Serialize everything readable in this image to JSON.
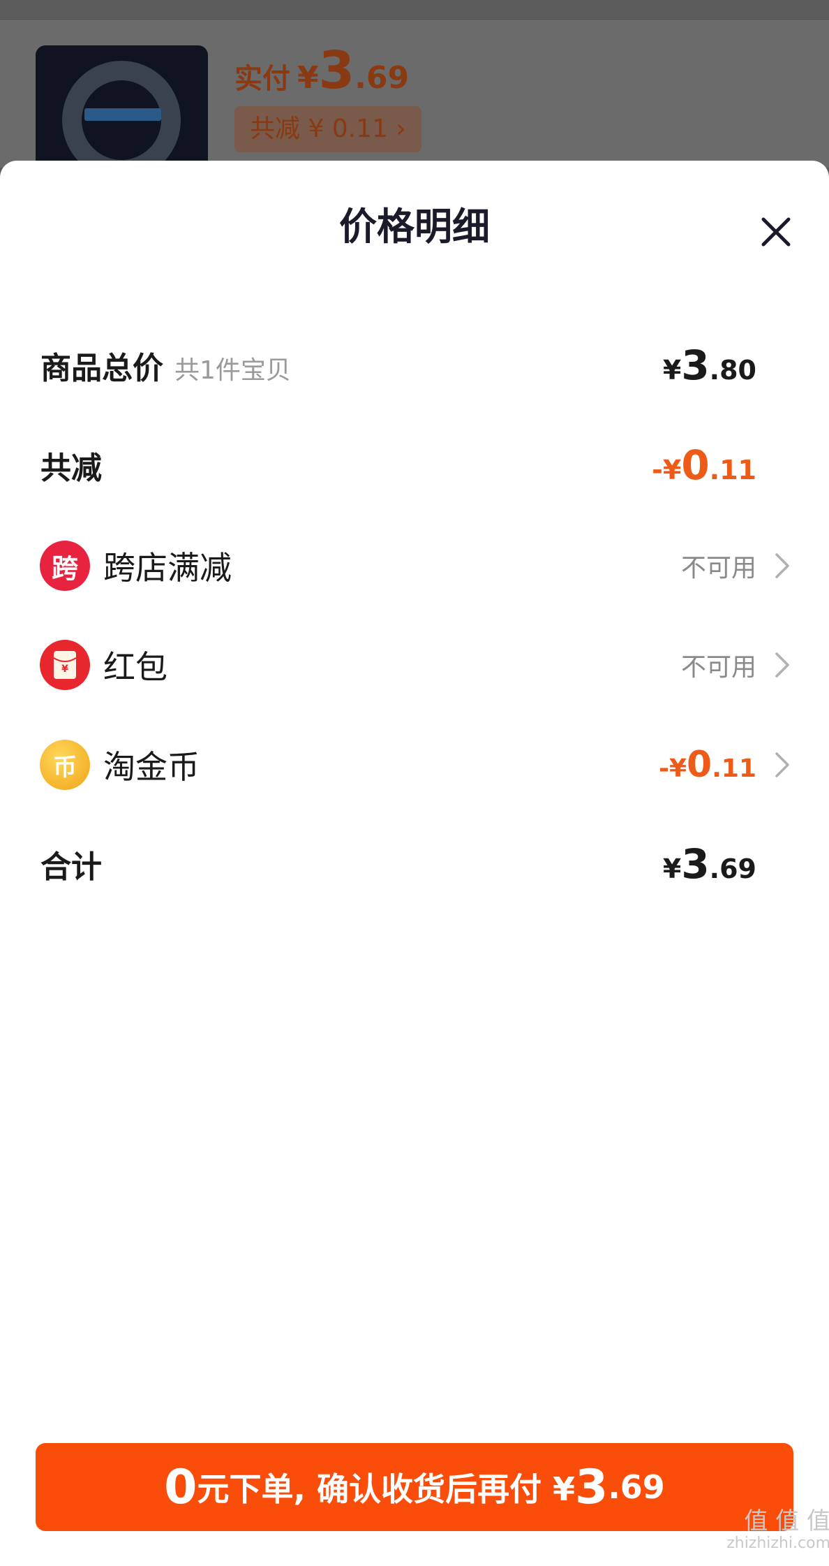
{
  "background": {
    "pay_label": "实付",
    "pay_currency": "¥",
    "pay_int": "3",
    "pay_dec": ".69",
    "save_text": "共减 ¥ 0.11 ›"
  },
  "sheet": {
    "title": "价格明细",
    "close_icon": "close-icon"
  },
  "rows": {
    "total": {
      "label": "商品总价",
      "sub": "共1件宝贝",
      "currency": "¥",
      "int": "3",
      "dec": ".80"
    },
    "discount": {
      "label": "共减",
      "currency": "-¥",
      "int": "0",
      "dec": ".11"
    },
    "cross_store": {
      "icon_text": "跨",
      "label": "跨店满减",
      "status": "不可用"
    },
    "red_packet": {
      "label": "红包",
      "status": "不可用"
    },
    "gold_coin": {
      "icon_text": "币",
      "label": "淘金币",
      "currency": "-¥",
      "int": "0",
      "dec": ".11"
    },
    "sum": {
      "label": "合计",
      "currency": "¥",
      "int": "3",
      "dec": ".69"
    }
  },
  "cta": {
    "big_prefix": "0",
    "middle": "元下单, 确认收货后再付 ¥",
    "big_int": "3",
    "dec": ".69"
  },
  "watermark": {
    "brand": "值 值 值",
    "url": "zhizhizhi.com"
  },
  "colors": {
    "accent": "#fa4d0a",
    "discount": "#ee5a17",
    "cross_store_icon": "#e8233f",
    "red_packet_icon": "#e8262e",
    "gold_coin_icon": "#f5b31f"
  }
}
